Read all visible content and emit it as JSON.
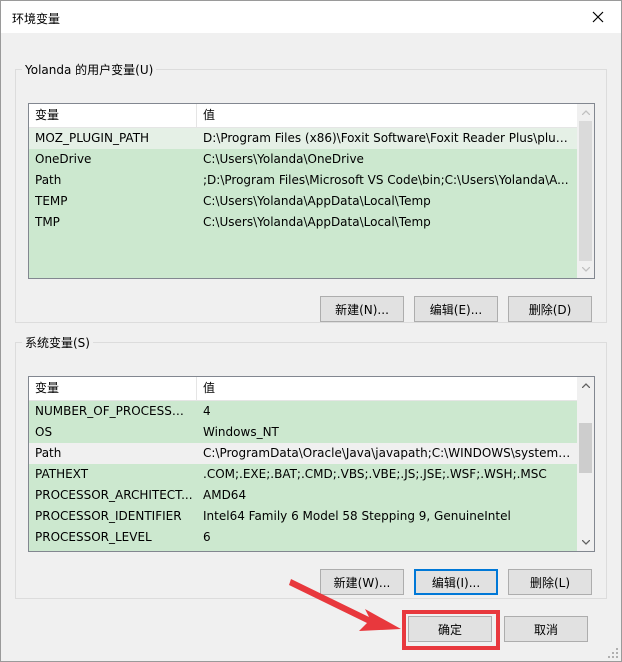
{
  "window": {
    "title": "环境变量"
  },
  "user_vars": {
    "group_label": "Yolanda 的用户变量(U)",
    "columns": [
      "变量",
      "值"
    ],
    "rows": [
      {
        "name": "MOZ_PLUGIN_PATH",
        "value": "D:\\Program Files (x86)\\Foxit Software\\Foxit Reader Plus\\plugi..."
      },
      {
        "name": "OneDrive",
        "value": "C:\\Users\\Yolanda\\OneDrive"
      },
      {
        "name": "Path",
        "value": ";D:\\Program Files\\Microsoft VS Code\\bin;C:\\Users\\Yolanda\\A..."
      },
      {
        "name": "TEMP",
        "value": "C:\\Users\\Yolanda\\AppData\\Local\\Temp"
      },
      {
        "name": "TMP",
        "value": "C:\\Users\\Yolanda\\AppData\\Local\\Temp"
      }
    ],
    "buttons": {
      "new": "新建(N)...",
      "edit": "编辑(E)...",
      "delete": "删除(D)"
    }
  },
  "system_vars": {
    "group_label": "系统变量(S)",
    "columns": [
      "变量",
      "值"
    ],
    "rows": [
      {
        "name": "NUMBER_OF_PROCESSORS",
        "value": "4"
      },
      {
        "name": "OS",
        "value": "Windows_NT"
      },
      {
        "name": "Path",
        "value": "C:\\ProgramData\\Oracle\\Java\\javapath;C:\\WINDOWS\\system3..."
      },
      {
        "name": "PATHEXT",
        "value": ".COM;.EXE;.BAT;.CMD;.VBS;.VBE;.JS;.JSE;.WSF;.WSH;.MSC"
      },
      {
        "name": "PROCESSOR_ARCHITECT...",
        "value": "AMD64"
      },
      {
        "name": "PROCESSOR_IDENTIFIER",
        "value": "Intel64 Family 6 Model 58 Stepping 9, GenuineIntel"
      },
      {
        "name": "PROCESSOR_LEVEL",
        "value": "6"
      }
    ],
    "buttons": {
      "new": "新建(W)...",
      "edit": "编辑(I)...",
      "delete": "删除(L)"
    }
  },
  "footer": {
    "ok": "确定",
    "cancel": "取消"
  },
  "colors": {
    "list_bg": "#cce8cf",
    "annotation_red": "#e8383d",
    "focus_blue": "#0078d7"
  },
  "icons": [
    "close-icon",
    "scroll-up-icon",
    "scroll-down-icon",
    "red-arrow-annotation",
    "resize-grip-icon"
  ]
}
